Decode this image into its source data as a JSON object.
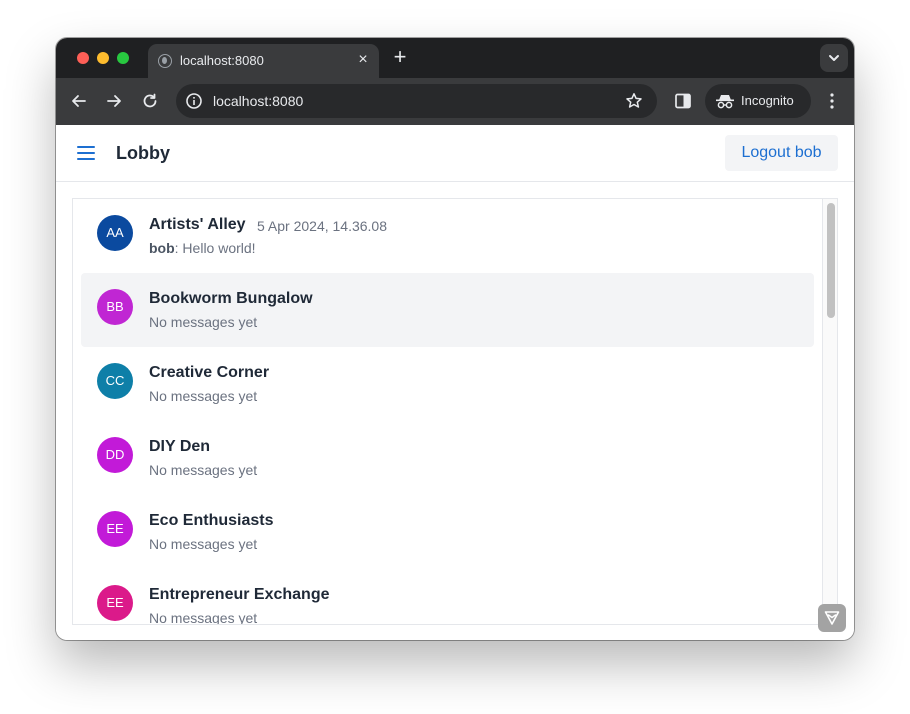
{
  "browser": {
    "tab_title": "localhost:8080",
    "url": "localhost:8080",
    "incognito_label": "Incognito",
    "icons": {
      "back": "arrow-left-icon",
      "forward": "arrow-right-icon",
      "reload": "reload-icon",
      "site_info": "info-icon",
      "bookmark": "star-icon",
      "side_panel": "side-panel-icon",
      "incognito": "incognito-icon",
      "menu": "kebab-menu-icon",
      "new_tab": "plus-icon",
      "tab_close": "close-icon",
      "tab_search": "chevron-down-icon"
    }
  },
  "header": {
    "title": "Lobby",
    "logout_label": "Logout bob",
    "menu_icon": "hamburger-menu-icon"
  },
  "rooms": [
    {
      "initials": "AA",
      "name": "Artists' Alley",
      "time": "5 Apr 2024, 14.36.08",
      "sender": "bob",
      "message": ": Hello world!",
      "color": "#0b4a9f"
    },
    {
      "initials": "BB",
      "name": "Bookworm Bungalow",
      "time": "",
      "preview": "No messages yet",
      "color": "#c026d3"
    },
    {
      "initials": "CC",
      "name": "Creative Corner",
      "time": "",
      "preview": "No messages yet",
      "color": "#0e7fa8"
    },
    {
      "initials": "DD",
      "name": "DIY Den",
      "time": "",
      "preview": "No messages yet",
      "color": "#c21ad8"
    },
    {
      "initials": "EE",
      "name": "Eco Enthusiasts",
      "time": "",
      "preview": "No messages yet",
      "color": "#c21ad8"
    },
    {
      "initials": "EE",
      "name": "Entrepreneur Exchange",
      "time": "",
      "preview": "No messages yet",
      "color": "#db1a8a"
    }
  ],
  "colors": {
    "accent": "#1d6fd1",
    "hover_row": "#f3f4f6"
  }
}
